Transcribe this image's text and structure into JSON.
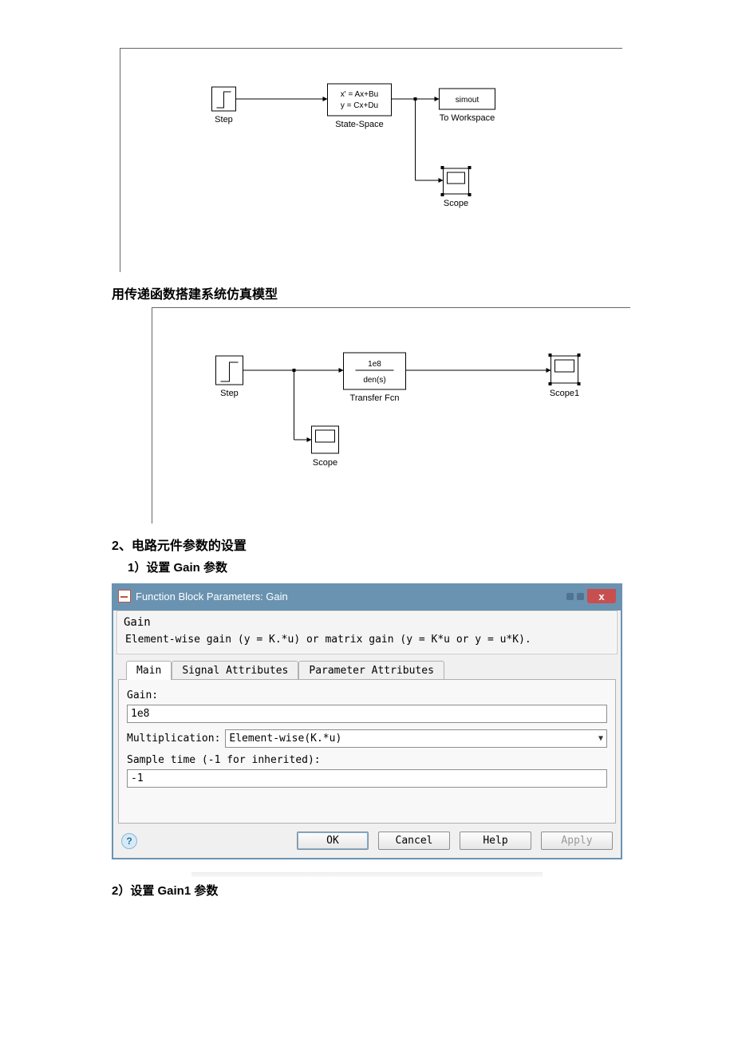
{
  "diagram1": {
    "step_label": "Step",
    "state_space_label": "State-Space",
    "state_space_eq1": "x' = Ax+Bu",
    "state_space_eq2": "y = Cx+Du",
    "simout_text": "simout",
    "simout_label": "To Workspace",
    "scope_label": "Scope"
  },
  "caption1": "用传递函数搭建系统仿真模型",
  "diagram2": {
    "step_label": "Step",
    "tf_num": "1e8",
    "tf_den": "den(s)",
    "tf_label": "Transfer Fcn",
    "scope_label": "Scope",
    "scope1_label": "Scope1"
  },
  "section2_title": "2、电路元件参数的设置",
  "section2_sub1": "1）设置 Gain 参数",
  "dialog": {
    "title": "Function Block Parameters: Gain",
    "block_name": "Gain",
    "description": "Element-wise gain (y = K.*u) or matrix gain (y = K*u or y = u*K).",
    "tabs": {
      "main": "Main",
      "signal": "Signal Attributes",
      "param": "Parameter Attributes"
    },
    "fields": {
      "gain_label": "Gain:",
      "gain_value": "1e8",
      "mult_label": "Multiplication:",
      "mult_value": "Element-wise(K.*u)",
      "sample_label": "Sample time (-1 for inherited):",
      "sample_value": "-1"
    },
    "buttons": {
      "ok": "OK",
      "cancel": "Cancel",
      "help": "Help",
      "apply": "Apply"
    }
  },
  "section2_sub2": "2）设置 Gain1 参数"
}
